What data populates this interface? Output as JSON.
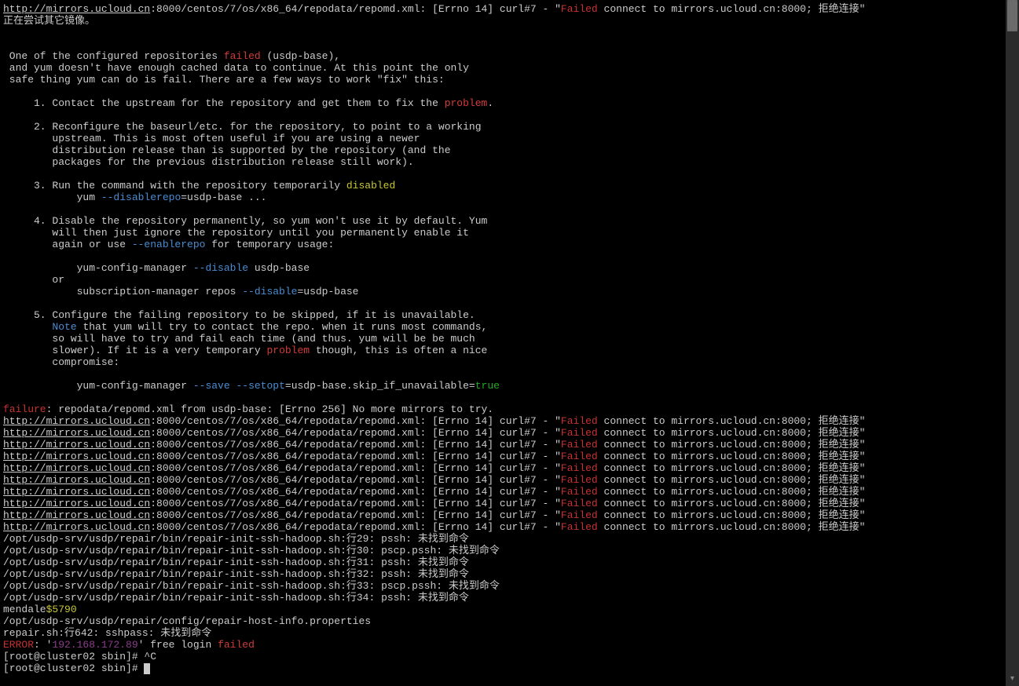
{
  "top_url": "http://mirrors.ucloud.cn",
  "top_rest": ":8000/centos/7/os/x86_64/repodata/repomd.xml: [Errno 14] curl#7 - \"",
  "failed": "Failed",
  "top_tail": " connect to mirrors.ucloud.cn:8000; 拒绝连接\"",
  "trying_other": "正在尝试其它镜像。",
  "msg_l1a": " One of the configured repositories ",
  "msg_l1b": " (usdp-base),",
  "msg_l2": " and yum doesn't have enough cached data to continue. At this point the only",
  "msg_l3": " safe thing yum can do is fail. There are a few ways to work \"fix\" this:",
  "item1a": "     1. Contact the upstream for the repository and get them to fix the ",
  "item1b": ".",
  "item2_l1": "     2. Reconfigure the baseurl/etc. for the repository, to point to a working",
  "item2_l2": "        upstream. This is most often useful if you are using a newer",
  "item2_l3": "        distribution release than is supported by the repository (and the",
  "item2_l4": "        packages for the previous distribution release still work).",
  "item3_l1a": "     3. Run the command with the repository temporarily ",
  "item3_l2a": "            yum ",
  "item3_l2b": "=usdp-base ...",
  "item4_l1": "     4. Disable the repository permanently, so yum won't use it by default. Yum",
  "item4_l2": "        will then just ignore the repository until you permanently enable it",
  "item4_l3a": "        again or use ",
  "item4_l3b": " for temporary usage:",
  "item4_cmd1a": "            yum-config-manager ",
  "item4_cmd1b": " usdp-base",
  "item4_or": "        or",
  "item4_cmd2a": "            subscription-manager repos ",
  "item4_cmd2b": "=usdp-base",
  "item5_l1": "     5. Configure the failing repository to be skipped, if it is unavailable.",
  "item5_l2a": "        ",
  "item5_l2b": " that yum will try to contact the repo. when it runs most commands,",
  "item5_l3": "        so will have to try and fail each time (and thus. yum will be be much",
  "item5_l4a": "        slower). If it is a very temporary ",
  "item5_l4b": " though, this is often a nice",
  "item5_l5": "        compromise:",
  "item5_cmd_a": "            yum-config-manager ",
  "item5_cmd_b": "=usdp-base.skip_if_unavailable=",
  "failure": "failure",
  "failure_rest": ": repodata/repomd.xml from usdp-base: [Errno 256] No more mirrors to try.",
  "err_url": "http://mirrors.ucloud.cn",
  "err_mid": ":8000/centos/7/os/x86_64/repodata/repomd.xml: [Errno 14] curl#7 - \"",
  "err_tail": " connect to mirrors.ucloud.cn:8000; 拒绝连接\"",
  "sh_line29": "/opt/usdp-srv/usdp/repair/bin/repair-init-ssh-hadoop.sh:行29: pssh: 未找到命令",
  "sh_line30": "/opt/usdp-srv/usdp/repair/bin/repair-init-ssh-hadoop.sh:行30: pscp.pssh: 未找到命令",
  "sh_line31": "/opt/usdp-srv/usdp/repair/bin/repair-init-ssh-hadoop.sh:行31: pssh: 未找到命令",
  "sh_line32": "/opt/usdp-srv/usdp/repair/bin/repair-init-ssh-hadoop.sh:行32: pssh: 未找到命令",
  "sh_line33": "/opt/usdp-srv/usdp/repair/bin/repair-init-ssh-hadoop.sh:行33: pscp.pssh: 未找到命令",
  "sh_line34": "/opt/usdp-srv/usdp/repair/bin/repair-init-ssh-hadoop.sh:行34: pssh: 未找到命令",
  "mendale": "mendale",
  "mendale_num": "$5790",
  "props_path": "/opt/usdp-srv/usdp/repair/config/repair-host-info.properties",
  "repair_sh": "repair.sh:行642: sshpass: 未找到命令",
  "error_label": "ERROR",
  "error_colon": ": '",
  "error_ip": "192.168.172.89",
  "error_rest": "' free login ",
  "prompt1": "[root@cluster02 sbin]# ^C",
  "prompt2": "[root@cluster02 sbin]# ",
  "kw_failed": "failed",
  "kw_problem": "problem",
  "kw_disabled": "disabled",
  "kw_disablerepo": "--disablerepo",
  "kw_enablerepo": "--enablerepo",
  "kw_disable": "--disable",
  "kw_save": "--save",
  "kw_setopt": "--setopt",
  "kw_true": "true",
  "kw_note": "Note"
}
